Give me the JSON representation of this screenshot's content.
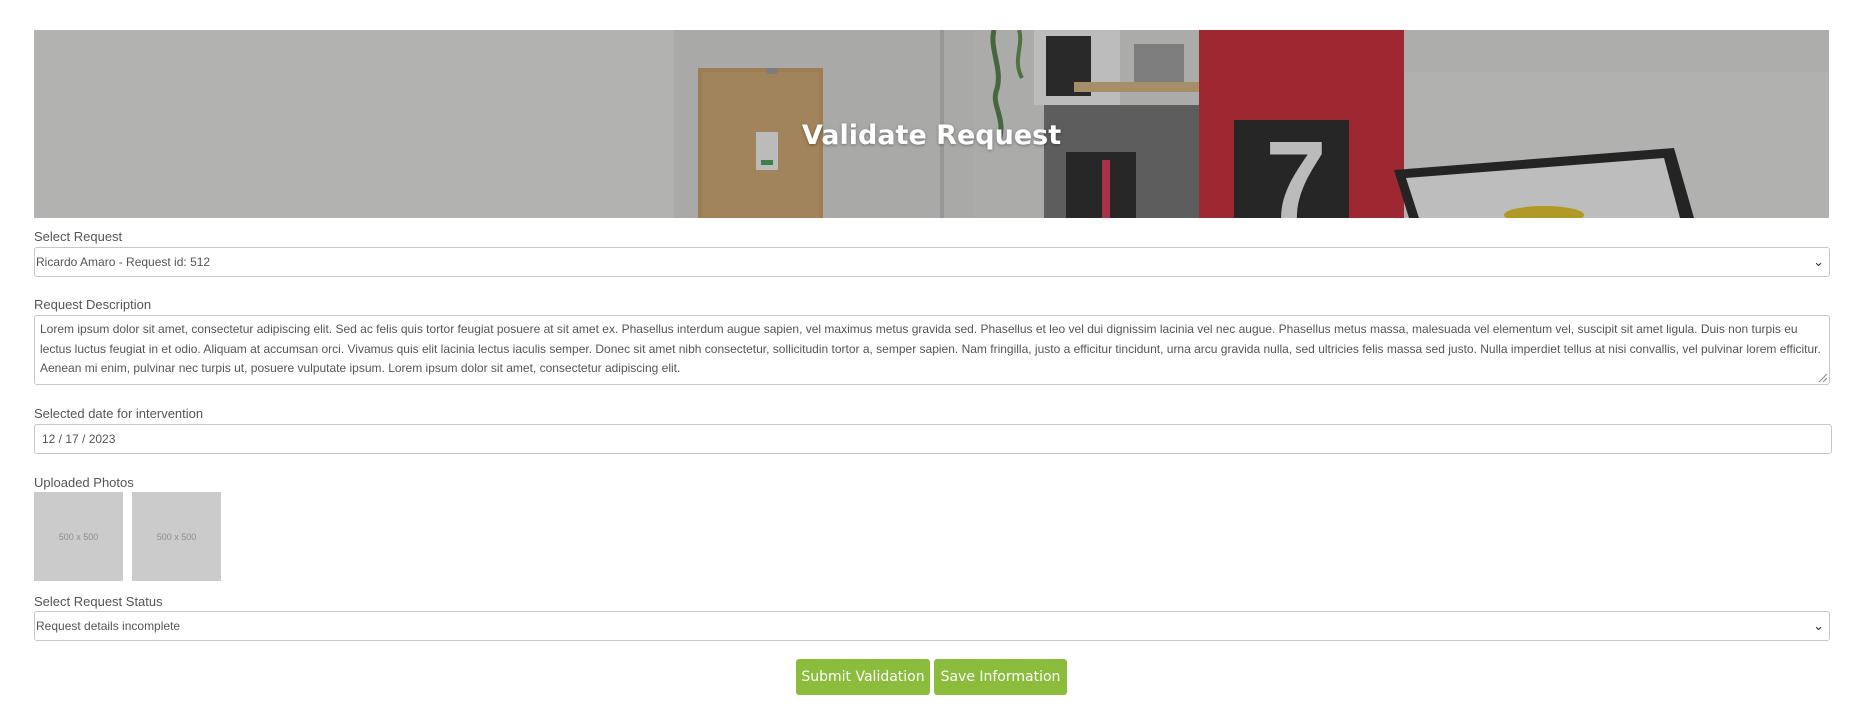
{
  "hero": {
    "title": "Validate Request"
  },
  "form": {
    "request_select": {
      "label": "Select Request",
      "value": "Ricardo Amaro - Request id: 512"
    },
    "description": {
      "label": "Request Description",
      "value": "Lorem ipsum dolor sit amet, consectetur adipiscing elit. Sed ac felis quis tortor feugiat posuere at sit amet ex. Phasellus interdum augue sapien, vel maximus metus gravida sed. Phasellus et leo vel dui dignissim lacinia vel nec augue. Phasellus metus massa, malesuada vel elementum vel, suscipit sit amet ligula. Duis non turpis eu lectus luctus feugiat in et odio. Aliquam at accumsan orci. Vivamus quis elit lacinia lectus iaculis semper. Donec sit amet nibh consectetur, sollicitudin tortor a, semper sapien. Nam fringilla, justo a efficitur tincidunt, urna arcu gravida nulla, sed ultricies felis massa sed justo. Nulla imperdiet tellus at nisi convallis, vel pulvinar lorem efficitur. Aenean mi enim, pulvinar nec turpis ut, posuere vulputate ipsum. Lorem ipsum dolor sit amet, consectetur adipiscing elit."
    },
    "date": {
      "label": "Selected date for intervention",
      "value": "12 / 17 / 2023"
    },
    "photos": {
      "label": "Uploaded Photos",
      "items": [
        {
          "placeholder": "500 x 500"
        },
        {
          "placeholder": "500 x 500"
        }
      ]
    },
    "status_select": {
      "label": "Select Request Status",
      "value": "Request details incomplete"
    }
  },
  "actions": {
    "submit_label": "Submit Validation",
    "save_label": "Save Information"
  },
  "colors": {
    "button_green": "#8cbc3c",
    "banner_overlay": "#3c3c3c",
    "border": "#c7c7c7",
    "text": "#555555"
  }
}
